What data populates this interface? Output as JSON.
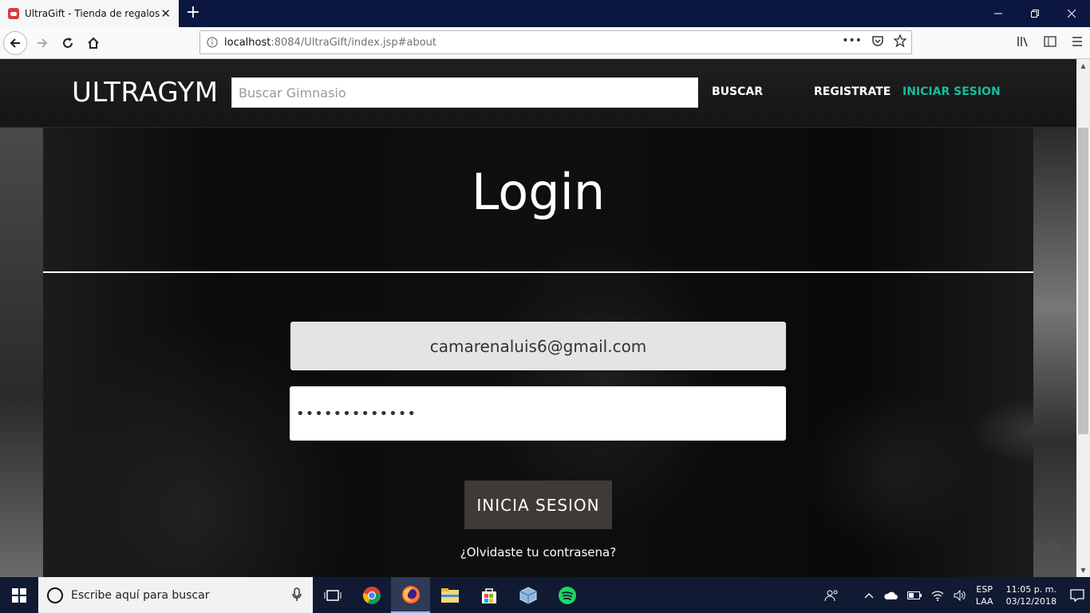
{
  "browser": {
    "tab_title": "UltraGift - Tienda de regalos",
    "tab_close": "✕",
    "new_tab": "+",
    "url_host": "localhost",
    "url_rest": ":8084/UltraGift/index.jsp#about",
    "url_more": "•••"
  },
  "site": {
    "brand": "ULTRAGYM",
    "search_placeholder": "Buscar Gimnasio",
    "nav": {
      "buscar": "BUSCAR",
      "registrate": "REGISTRATE",
      "iniciar_sesion": "INICIAR SESION"
    },
    "accent_color": "#1abc9c"
  },
  "login": {
    "title": "Login",
    "email_value": "camarenaluis6@gmail.com",
    "password_value": "aaaaaaaaaaaaa",
    "submit_label": "INICIA SESION",
    "forgot_link": "¿Olvidaste tu contrasena?",
    "subir_link": "Subir"
  },
  "taskbar": {
    "search_text": "Escribe aquí para buscar",
    "lang_top": "ESP",
    "lang_bottom": "LAA",
    "time": "11:05 p. m.",
    "date": "03/12/2018"
  }
}
